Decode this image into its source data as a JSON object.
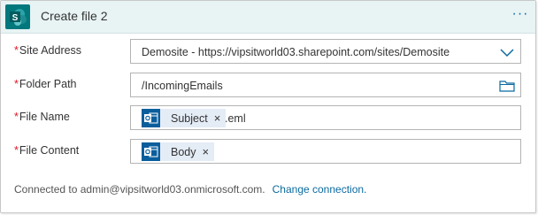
{
  "card": {
    "title": "Create file 2",
    "more_label": "···",
    "app_icon": "sharepoint-icon",
    "colors": {
      "header_bg": "#e8f3f4",
      "app_icon_bg": "#03787c",
      "link": "#0b6a9f",
      "required": "#e81123"
    }
  },
  "fields": {
    "site_address": {
      "required_mark": "*",
      "label": "Site Address",
      "value": "Demosite - https://vipsitworld03.sharepoint.com/sites/Demosite",
      "icon": "chevron-down-icon"
    },
    "folder_path": {
      "required_mark": "*",
      "label": "Folder Path",
      "value": "/IncomingEmails",
      "icon": "folder-icon"
    },
    "file_name": {
      "required_mark": "*",
      "label": "File Name",
      "token": {
        "label": "Subject",
        "remove": "×",
        "icon": "outlook-icon"
      },
      "suffix": ".eml"
    },
    "file_content": {
      "required_mark": "*",
      "label": "File Content",
      "token": {
        "label": "Body",
        "remove": "×",
        "icon": "outlook-icon"
      }
    }
  },
  "footer": {
    "connection_text": "Connected to admin@vipsitworld03.onmicrosoft.com.",
    "change_link": "Change connection."
  }
}
